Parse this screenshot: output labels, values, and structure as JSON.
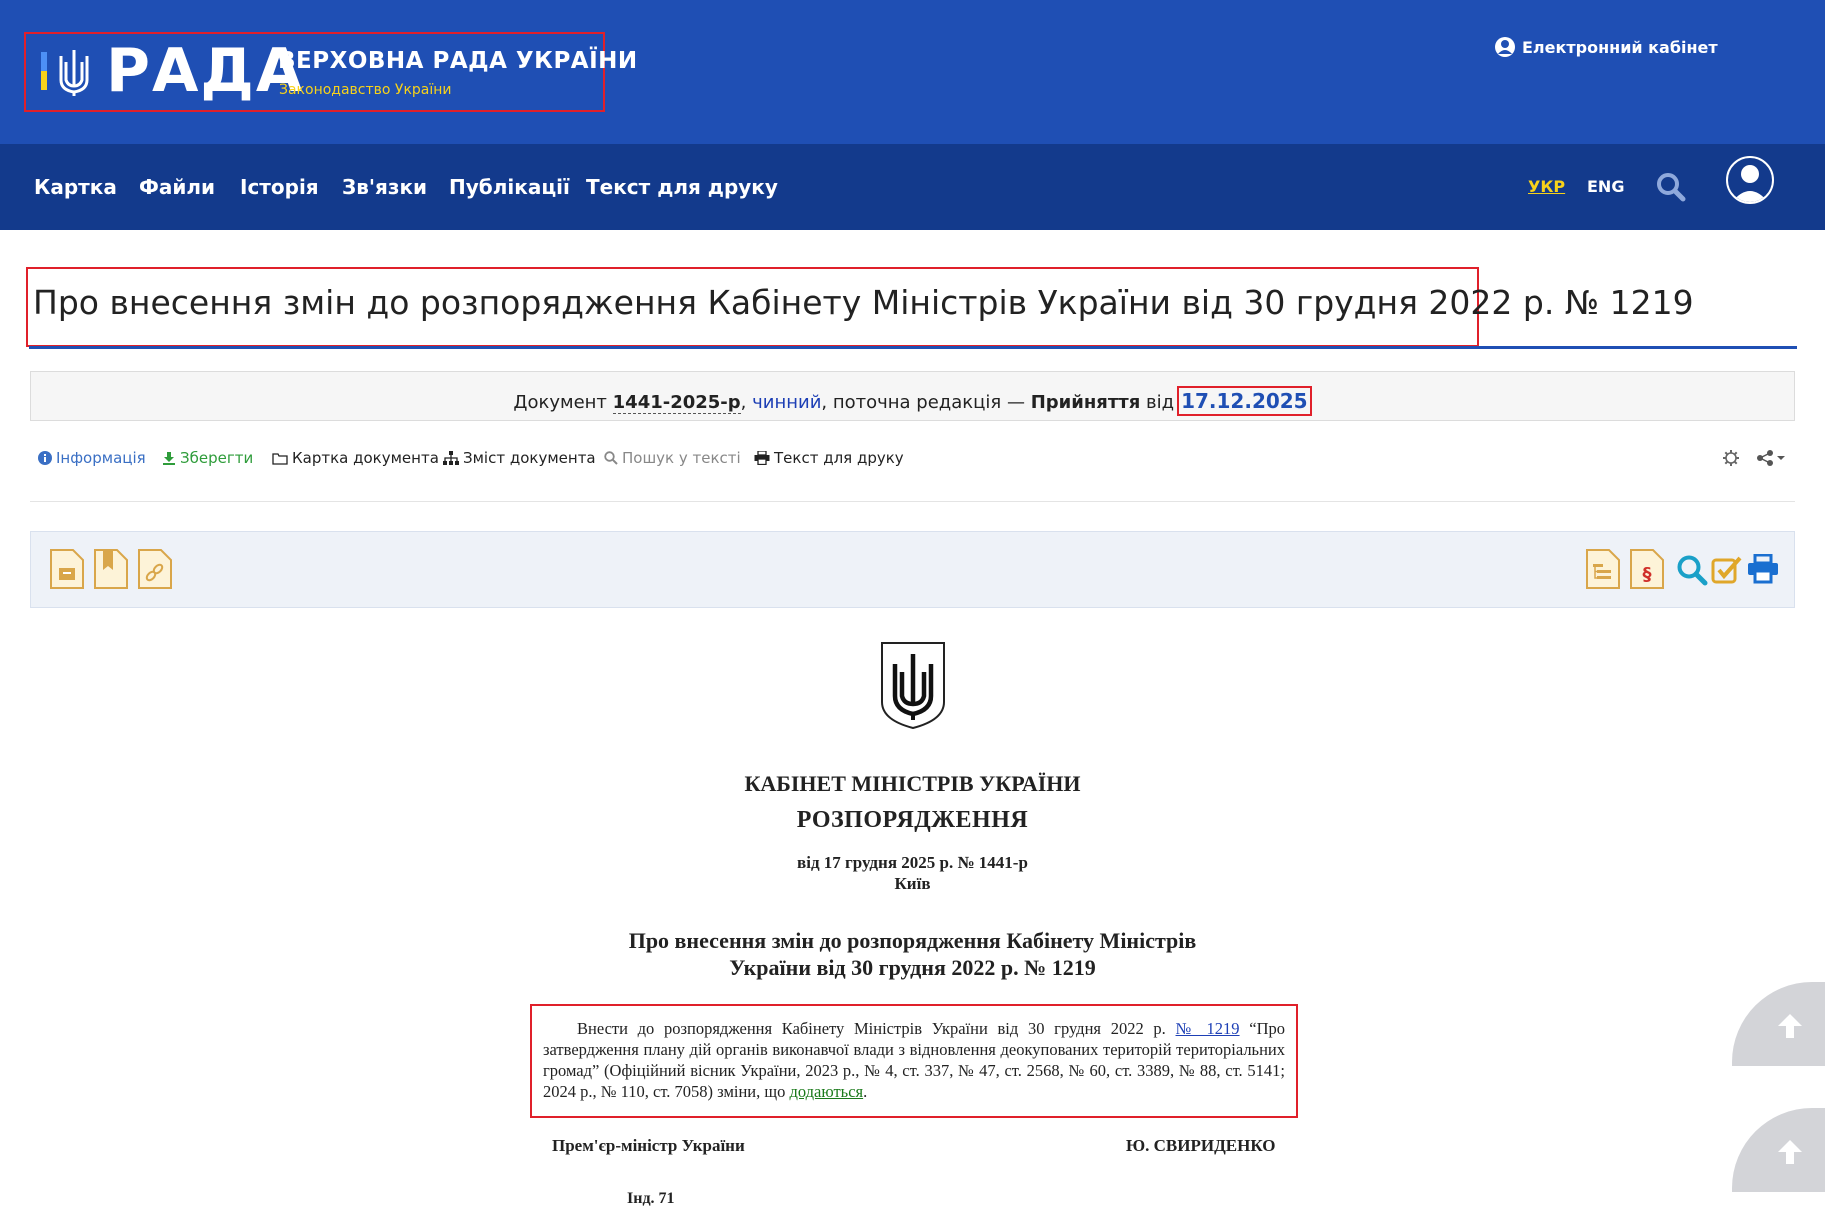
{
  "header": {
    "logo_word": "РАДА",
    "logo_title": "ВЕРХОВНА РАДА УКРАЇНИ",
    "logo_subtitle": "Законодавство України",
    "cabinet_label": "Електронний кабінет"
  },
  "nav": {
    "items": [
      "Картка",
      "Файли",
      "Історія",
      "Зв'язки",
      "Публікації",
      "Текст для друку"
    ],
    "lang_ukr": "УКР",
    "lang_eng": "ENG"
  },
  "page": {
    "title": "Про внесення змін до розпорядження Кабінету Міністрів України від 30 грудня 2022 р. № 1219"
  },
  "status": {
    "doc_prefix": "Документ",
    "doc_number": "1441-2025-р",
    "separator": ",",
    "validity": "чинний",
    "edition_text": ", поточна редакція —",
    "edition_type": "Прийняття",
    "from_word": "від",
    "date": "17.12.2025"
  },
  "toolbar": {
    "info": "Інформація",
    "save": "Зберегти",
    "card": "Картка документа",
    "contents": "Зміст документа",
    "search": "Пошук у тексті",
    "print": "Текст для друку"
  },
  "document": {
    "authority": "КАБІНЕТ МІНІСТРІВ УКРАЇНИ",
    "doc_type": "РОЗПОРЯДЖЕННЯ",
    "date_line": "від 17 грудня 2025 р. № 1441-р",
    "city": "Київ",
    "title_line1": "Про внесення змін до розпорядження Кабінету Міністрів",
    "title_line2": "України від 30 грудня 2022 р. № 1219",
    "paragraph_before": "Внести до розпорядження Кабінету Міністрів України від 30 грудня 2022 р.",
    "link_number": "№ 1219",
    "paragraph_middle": "“Про затвердження плану дій органів виконавчої влади з відновлення деокупованих територій територіальних громад” (Офіційний вісник України, 2023 р., № 4, ст. 337, № 47, ст. 2568, № 60, ст. 3389, № 88, ст. 5141; 2024 р., № 110, ст. 7058) зміни, що",
    "link_attached": "додаються",
    "paragraph_end": ".",
    "signer_position": "Прем'єр-міністр України",
    "signer_name": "Ю. СВИРИДЕНКО",
    "index": "Інд. 71"
  },
  "colors": {
    "topbar": "#1f4fb4",
    "navbar": "#133a8c",
    "accent_yellow": "#f7d21a",
    "highlight_red": "#e0202a"
  }
}
